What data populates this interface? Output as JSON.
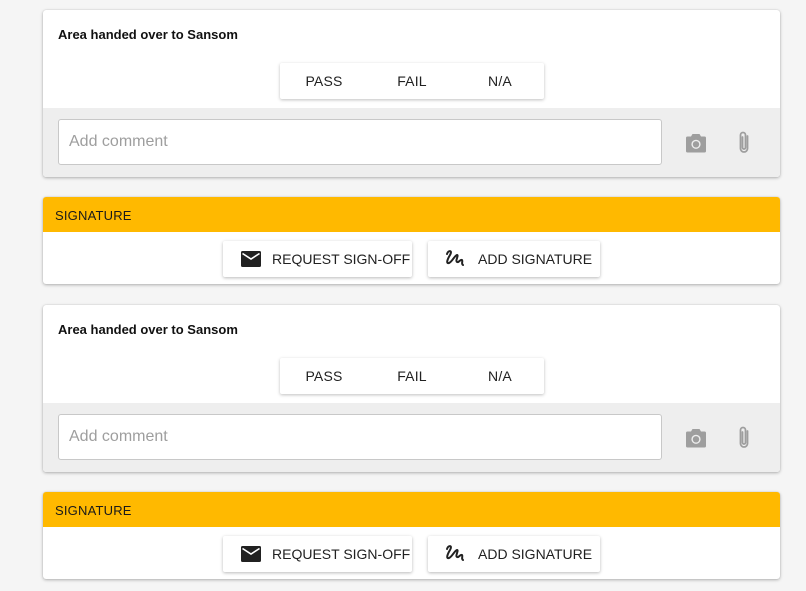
{
  "sections": [
    {
      "question": {
        "title": "Area handed over to Sansom",
        "options": [
          "PASS",
          "FAIL",
          "N/A"
        ],
        "comment_placeholder": "Add comment",
        "camera_icon": "camera-icon",
        "attach_icon": "paperclip-icon"
      },
      "signature": {
        "title": "SIGNATURE",
        "request_label": "REQUEST SIGN-OFF",
        "request_icon": "mail-icon",
        "add_label": "ADD SIGNATURE",
        "add_icon": "signature-icon"
      }
    },
    {
      "question": {
        "title": "Area handed over to Sansom",
        "options": [
          "PASS",
          "FAIL",
          "N/A"
        ],
        "comment_placeholder": "Add comment",
        "camera_icon": "camera-icon",
        "attach_icon": "paperclip-icon"
      },
      "signature": {
        "title": "SIGNATURE",
        "request_label": "REQUEST SIGN-OFF",
        "request_icon": "mail-icon",
        "add_label": "ADD SIGNATURE",
        "add_icon": "signature-icon"
      }
    }
  ],
  "colors": {
    "signature_header": "#ffb900",
    "comment_row": "#eeeeee",
    "page_background": "#f5f5f5"
  }
}
